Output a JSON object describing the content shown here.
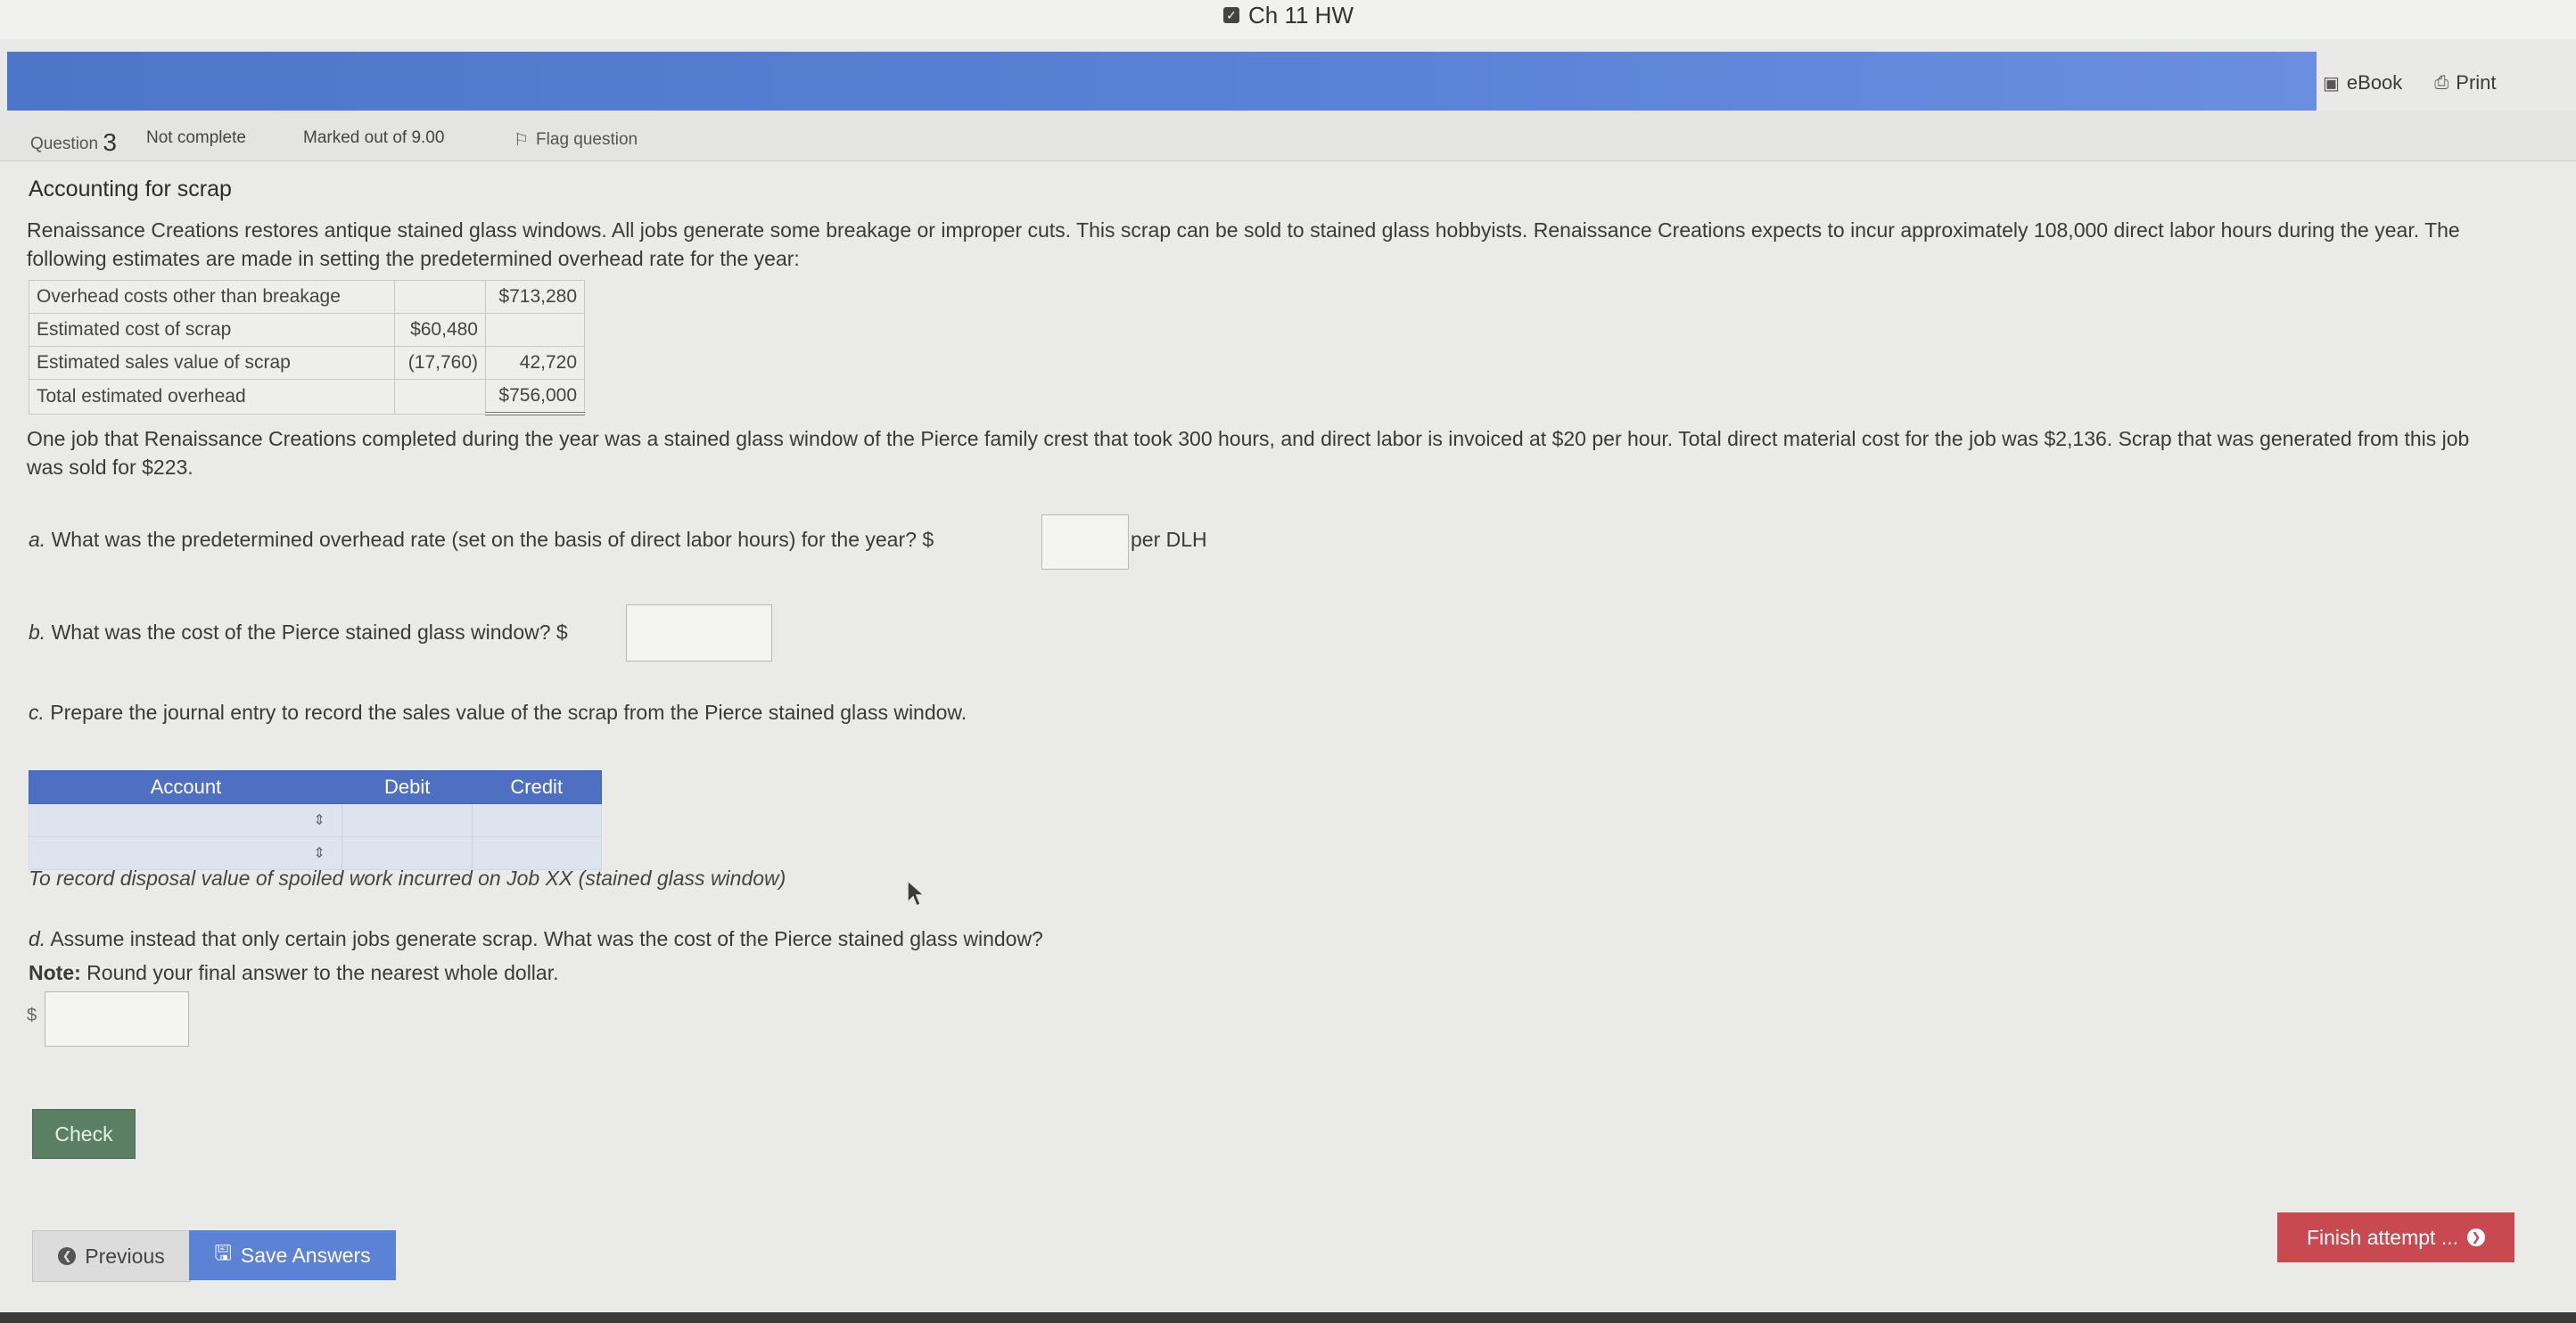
{
  "window": {
    "title": "Ch 11 HW"
  },
  "tools": {
    "ebook": "eBook",
    "print": "Print"
  },
  "question_info": {
    "question_label": "Question",
    "question_number": "3",
    "status": "Not complete",
    "marks": "Marked out of 9.00",
    "flag": "Flag question"
  },
  "problem": {
    "title": "Accounting for scrap",
    "intro": "Renaissance Creations restores antique stained glass windows. All jobs generate some breakage or improper cuts. This scrap can be sold to stained glass hobbyists. Renaissance Creations expects to incur approximately 108,000 direct labor hours during the year. The following estimates are made in setting the predetermined overhead rate for the year:",
    "estimates": [
      {
        "label": "Overhead costs other than breakage",
        "col2": "",
        "col3": "$713,280"
      },
      {
        "label": "Estimated cost of scrap",
        "col2": "$60,480",
        "col3": ""
      },
      {
        "label": "Estimated sales value of scrap",
        "col2": "(17,760)",
        "col3": "42,720"
      },
      {
        "label": "Total estimated overhead",
        "col2": "",
        "col3": "$756,000"
      }
    ],
    "job_text": "One job that Renaissance Creations completed during the year was a stained glass window of the Pierce family crest that took 300 hours, and direct labor is invoiced at $20 per hour. Total direct material cost for the job was $2,136. Scrap that was generated from this job was sold for $223."
  },
  "parts": {
    "a_letter": "a.",
    "a_text": "What was the predetermined overhead rate (set on the basis of direct labor hours) for the year? $",
    "a_value": "",
    "a_unit": "per DLH",
    "b_letter": "b.",
    "b_text": "What was the cost of the Pierce stained glass window? $",
    "b_value": "",
    "c_letter": "c.",
    "c_text": "Prepare the journal entry to record the sales value of the scrap from the Pierce stained glass window.",
    "d_letter": "d.",
    "d_text": "Assume instead that only certain jobs generate scrap. What was the cost of the Pierce stained glass window?",
    "note_label": "Note:",
    "note_text": "Round your final answer to the nearest whole dollar.",
    "d_prefix": "$",
    "d_value": ""
  },
  "journal": {
    "headers": {
      "account": "Account",
      "debit": "Debit",
      "credit": "Credit"
    },
    "caption": "To record disposal value of spoiled work incurred on Job XX (stained glass window)"
  },
  "buttons": {
    "check": "Check",
    "previous": "Previous",
    "save": "Save Answers",
    "finish": "Finish attempt ..."
  }
}
